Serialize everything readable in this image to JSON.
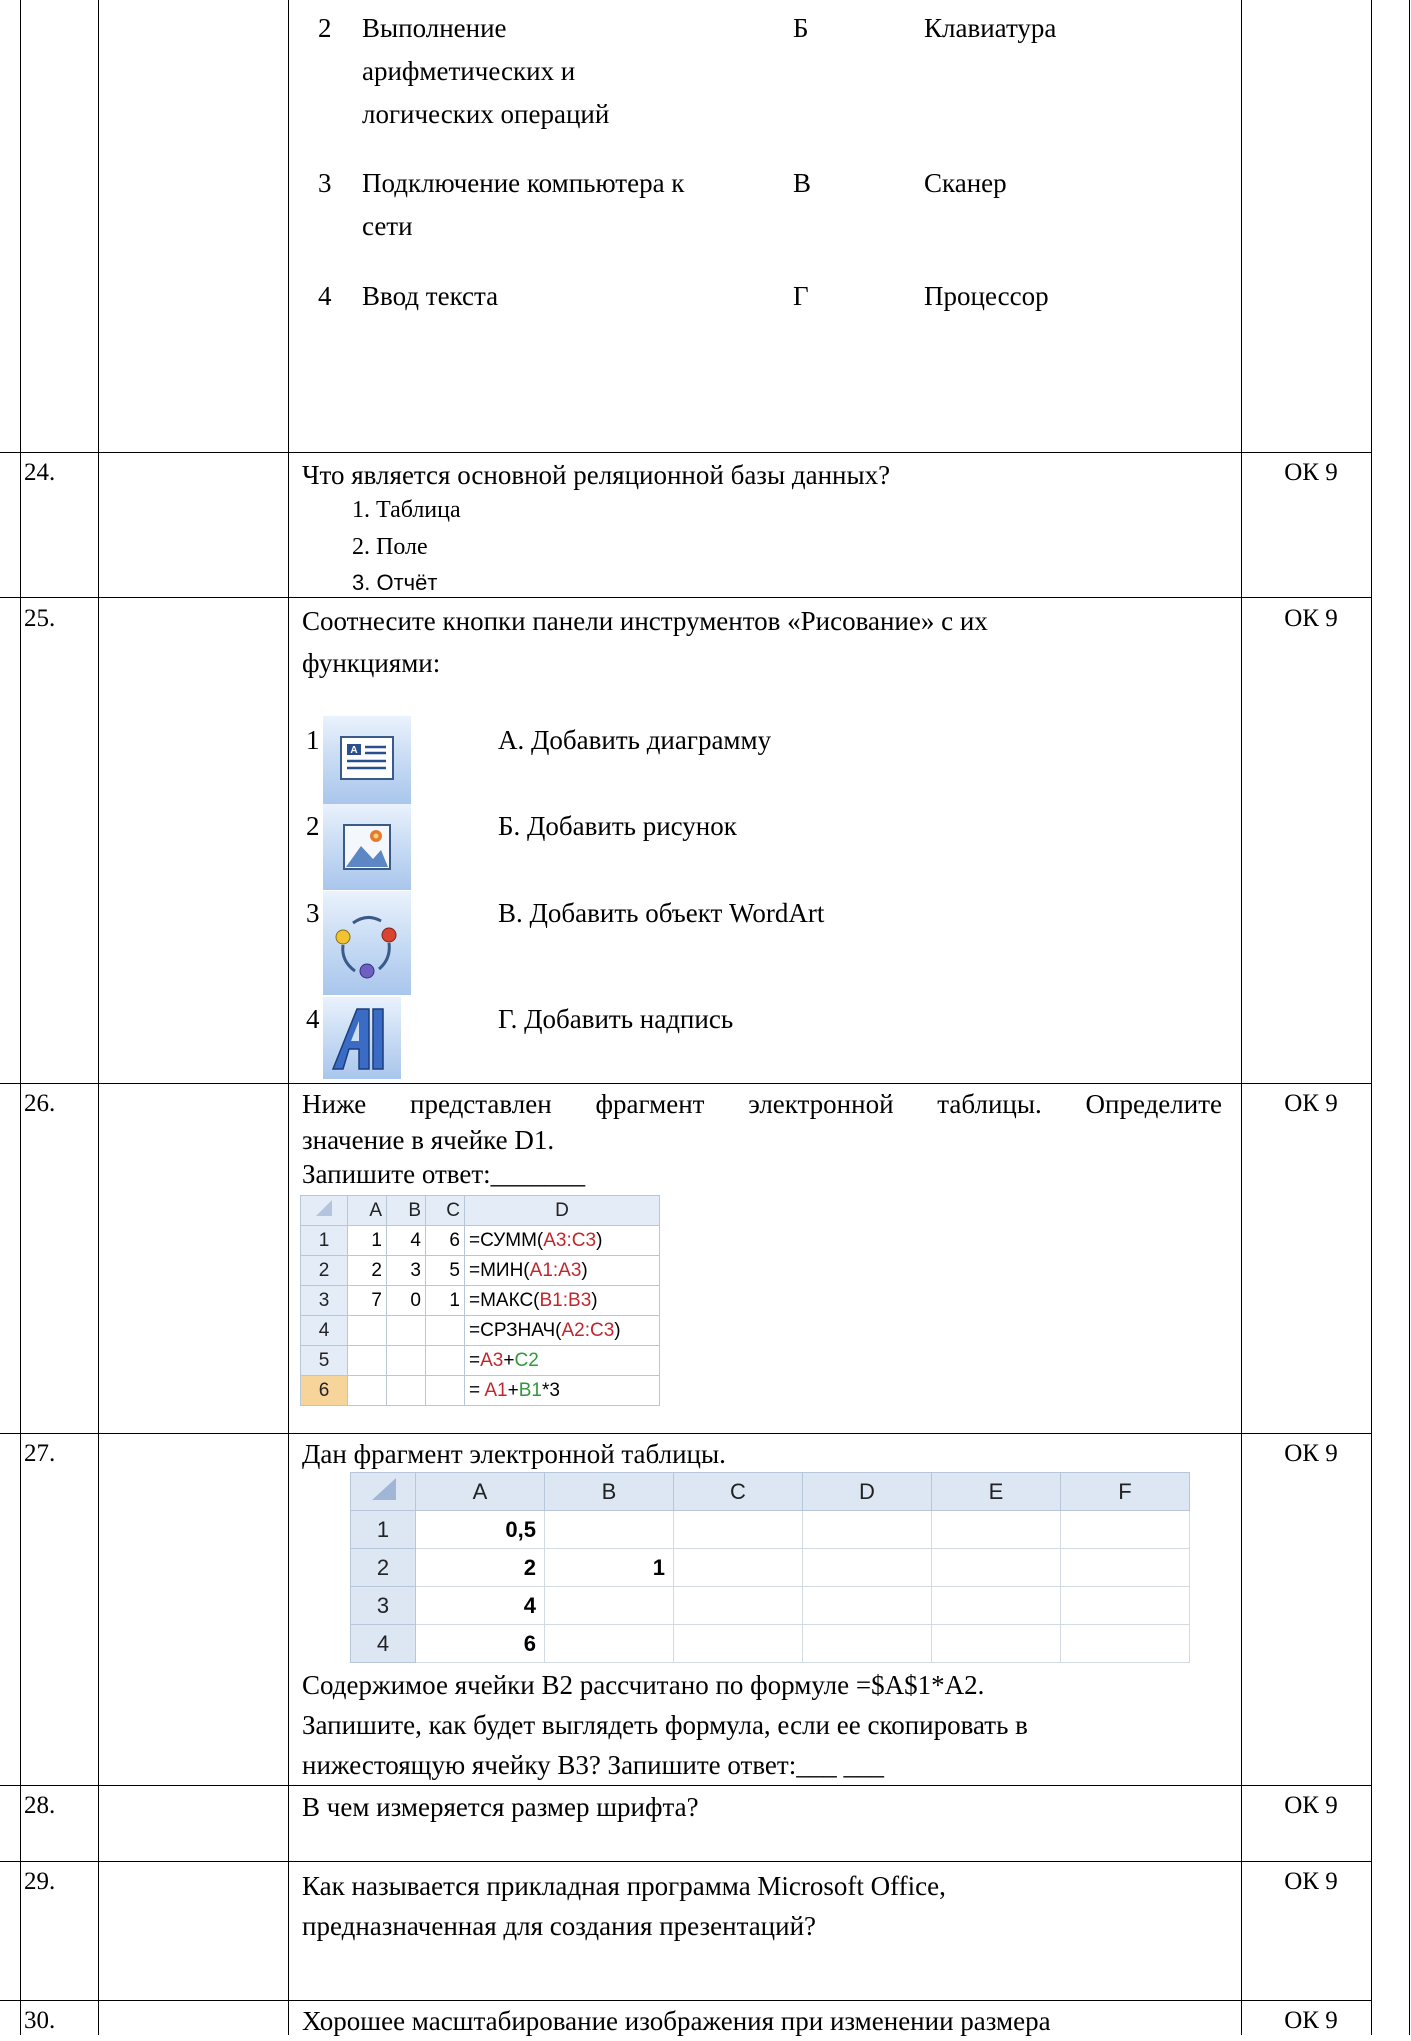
{
  "carryover": {
    "rows": [
      {
        "n": "2",
        "text_lines": [
          "Выполнение",
          "арифметических и",
          "логических операций"
        ],
        "letter": "Б",
        "device": "Клавиатура"
      },
      {
        "n": "3",
        "text_lines": [
          "Подключение компьютера к",
          "сети"
        ],
        "letter": "В",
        "device": "Сканер"
      },
      {
        "n": "4",
        "text_lines": [
          "Ввод текста"
        ],
        "letter": "Г",
        "device": "Процессор"
      }
    ]
  },
  "questions": {
    "q24": {
      "number": "24.",
      "code": "ОК 9",
      "text": "Что является основной реляционной  базы данных?",
      "options": [
        "1.  Таблица",
        "2.  Поле",
        "3.  Отчёт"
      ]
    },
    "q25": {
      "number": "25.",
      "code": "ОК 9",
      "text_lines": [
        "Соотнесите кнопки панели инструментов «Рисование» с их",
        "функциями:"
      ],
      "items": [
        {
          "n": "1",
          "icon": "text-box-icon",
          "label": "А. Добавить диаграмму"
        },
        {
          "n": "2",
          "icon": "insert-picture-icon",
          "label": "Б. Добавить рисунок"
        },
        {
          "n": "3",
          "icon": "diagram-cycle-icon",
          "label": "В. Добавить объект WordArt"
        },
        {
          "n": "4",
          "icon": "wordart-icon",
          "label": "Г. Добавить надпись"
        }
      ]
    },
    "q26": {
      "number": "26.",
      "code": "ОК 9",
      "text_lines": [
        "Ниже представлен фрагмент электронной таблицы. Определите",
        "значение в ячейке D1."
      ],
      "answer": "Запишите ответ:_______",
      "sheet": {
        "headers": [
          "",
          "A",
          "B",
          "C",
          "D"
        ],
        "rows": [
          {
            "r": "1",
            "a": "1",
            "b": "4",
            "c": "6",
            "d": [
              [
                "=СУММ(",
                ""
              ],
              [
                "A3:C3",
                "red"
              ],
              [
                ")",
                ""
              ]
            ]
          },
          {
            "r": "2",
            "a": "2",
            "b": "3",
            "c": "5",
            "d": [
              [
                "=МИН(",
                ""
              ],
              [
                "A1:A3",
                "red"
              ],
              [
                ")",
                ""
              ]
            ]
          },
          {
            "r": "3",
            "a": "7",
            "b": "0",
            "c": "1",
            "d": [
              [
                "=МАКС(",
                ""
              ],
              [
                "B1:B3",
                "red"
              ],
              [
                ")",
                ""
              ]
            ]
          },
          {
            "r": "4",
            "a": "",
            "b": "",
            "c": "",
            "d": [
              [
                "=СРЗНАЧ(",
                ""
              ],
              [
                "A2:C3",
                "red"
              ],
              [
                ")",
                ""
              ]
            ]
          },
          {
            "r": "5",
            "a": "",
            "b": "",
            "c": "",
            "d": [
              [
                "=",
                ""
              ],
              [
                "A3",
                "red"
              ],
              [
                "+",
                ""
              ],
              [
                "C2",
                "grn"
              ]
            ]
          },
          {
            "r": "6",
            "a": "",
            "b": "",
            "c": "",
            "d": [
              [
                "= ",
                ""
              ],
              [
                "A1",
                "red"
              ],
              [
                "+",
                ""
              ],
              [
                "B1",
                "grn"
              ],
              [
                "*3",
                ""
              ]
            ]
          }
        ]
      }
    },
    "q27": {
      "number": "27.",
      "code": "ОК 9",
      "text": "Дан фрагмент электронной таблицы.",
      "sheet": {
        "headers": [
          "",
          "A",
          "B",
          "C",
          "D",
          "E",
          "F"
        ],
        "rows": [
          [
            "1",
            "0,5",
            "",
            "",
            "",
            "",
            ""
          ],
          [
            "2",
            "2",
            "1",
            "",
            "",
            "",
            ""
          ],
          [
            "3",
            "4",
            "",
            "",
            "",
            "",
            ""
          ],
          [
            "4",
            "6",
            "",
            "",
            "",
            "",
            ""
          ]
        ]
      },
      "after_lines": [
        "Содержимое ячейки B2 рассчитано по формуле =$A$1*A2.",
        "Запишите, как будет выглядеть формула, если ее скопировать в",
        "нижестоящую ячейку B3? Запишите ответ:___ ___"
      ]
    },
    "q28": {
      "number": "28.",
      "code": "ОК 9",
      "text": "В чем измеряется размер шрифта?"
    },
    "q29": {
      "number": "29.",
      "code": "ОК 9",
      "text_lines": [
        "Как называется прикладная программа Microsoft Office,",
        "предназначенная для создания презентаций?"
      ]
    },
    "q30": {
      "number": "30.",
      "code": "ОК 9",
      "text": "Хорошее масштабирование изображения при изменении размера"
    }
  }
}
